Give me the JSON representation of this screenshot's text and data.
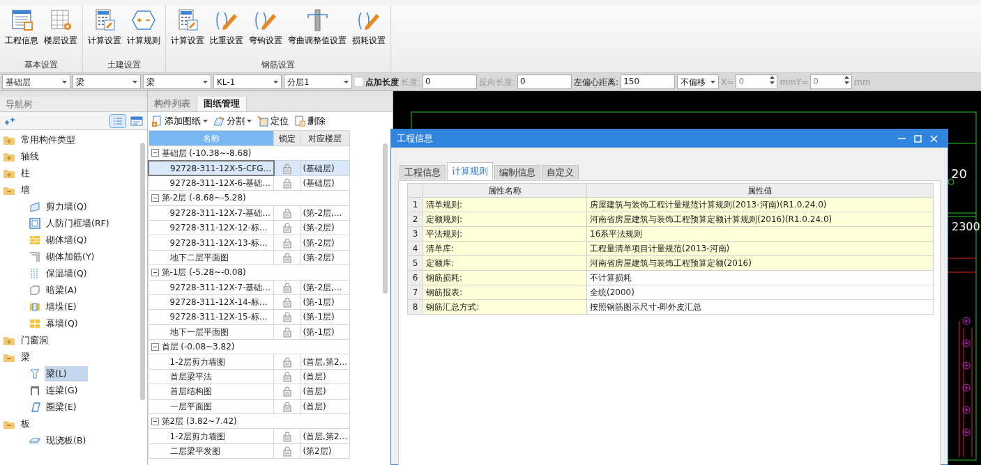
{
  "ribbon": {
    "groups": [
      {
        "label": "基本设置",
        "buttons": [
          "工程信息",
          "楼层设置"
        ]
      },
      {
        "label": "土建设置",
        "buttons": [
          "计算设置",
          "计算规则"
        ]
      },
      {
        "label": "钢筋设置",
        "buttons": [
          "计算设置",
          "比重设置",
          "弯钩设置",
          "弯曲调整值设置",
          "损耗设置"
        ]
      }
    ]
  },
  "toolbar": [
    {
      "kind": "select",
      "value": "基础层"
    },
    {
      "kind": "select",
      "value": "梁"
    },
    {
      "kind": "select",
      "value": "梁"
    },
    {
      "kind": "select",
      "value": "KL-1"
    },
    {
      "kind": "select",
      "value": "分层1"
    },
    {
      "kind": "checkbox",
      "label": "点加长度",
      "checked": false
    },
    {
      "kind": "input",
      "label": "长度:",
      "value": "0",
      "disabled": true
    },
    {
      "kind": "input",
      "label": "反向长度:",
      "value": "0",
      "disabled": true
    },
    {
      "kind": "input",
      "label": "左偏心距离:",
      "value": "150",
      "disabled": false
    },
    {
      "kind": "select",
      "value": "不偏移"
    },
    {
      "kind": "spin",
      "label": "X=",
      "value": "0",
      "disabled": true
    },
    {
      "kind": "spin",
      "label": "mmY=",
      "value": "0",
      "disabled": true
    },
    {
      "kind": "unit",
      "label": "mm",
      "disabled": true
    }
  ],
  "nav": {
    "title": "导航树",
    "items": [
      {
        "label": "常用构件类型",
        "expanded": false
      },
      {
        "label": "轴线",
        "expanded": false
      },
      {
        "label": "柱",
        "expanded": false
      },
      {
        "label": "墙",
        "expanded": true,
        "children": [
          {
            "label": "剪力墙(Q)",
            "selected": false
          },
          {
            "label": "人防门框墙(RF)",
            "selected": false
          },
          {
            "label": "砌体墙(Q)",
            "selected": false
          },
          {
            "label": "砌体加筋(Y)",
            "selected": false
          },
          {
            "label": "保温墙(Q)",
            "selected": false
          },
          {
            "label": "暗梁(A)",
            "selected": false
          },
          {
            "label": "墙垛(E)",
            "selected": false
          },
          {
            "label": "幕墙(Q)",
            "selected": false
          }
        ]
      },
      {
        "label": "门窗洞",
        "expanded": false
      },
      {
        "label": "梁",
        "expanded": true,
        "children": [
          {
            "label": "梁(L)",
            "selected": true
          },
          {
            "label": "连梁(G)",
            "selected": false
          },
          {
            "label": "圈梁(E)",
            "selected": false
          }
        ]
      },
      {
        "label": "板",
        "expanded": true,
        "children": [
          {
            "label": "现浇板(B)",
            "selected": false
          }
        ]
      }
    ]
  },
  "drawings": {
    "tabs": [
      {
        "label": "构件列表",
        "selected": false
      },
      {
        "label": "图纸管理",
        "selected": true
      }
    ],
    "actions": [
      {
        "label": "添加图纸",
        "dropdown": true
      },
      {
        "label": "分割",
        "dropdown": true
      },
      {
        "label": "定位",
        "dropdown": false
      },
      {
        "label": "删除",
        "dropdown": false
      }
    ],
    "columns": [
      "名称",
      "锁定",
      "对应楼层"
    ],
    "groups": [
      {
        "label": "基础层 (-10.38~-8.68)",
        "expanded": true,
        "rows": [
          {
            "name": "92728-311-12X-5-CFG...",
            "floor": "(基础层)",
            "selected": true
          },
          {
            "name": "92728-311-12X-6-基础...",
            "floor": "(基础层)",
            "selected": false
          }
        ]
      },
      {
        "label": "第-2层 (-8.68~-5.28)",
        "expanded": true,
        "rows": [
          {
            "name": "92728-311-12X-7-基础...",
            "floor": "(第-2层,...",
            "selected": false
          },
          {
            "name": "92728-311-12X-12-标...",
            "floor": "(第-2层)",
            "selected": false
          },
          {
            "name": "92728-311-12X-13-标...",
            "floor": "(第-2层)",
            "selected": false
          },
          {
            "name": "地下二层平面图",
            "floor": "(第-2层)",
            "selected": false
          }
        ]
      },
      {
        "label": "第-1层 (-5.28~-0.08)",
        "expanded": true,
        "rows": [
          {
            "name": "92728-311-12X-7-基础...",
            "floor": "(第-2层,...",
            "selected": false
          },
          {
            "name": "92728-311-12X-14-标...",
            "floor": "(第-1层)",
            "selected": false
          },
          {
            "name": "92728-311-12X-15-标...",
            "floor": "(第-1层)",
            "selected": false
          },
          {
            "name": "地下一层平面图",
            "floor": "(第-1层)",
            "selected": false
          }
        ]
      },
      {
        "label": "首层 (-0.08~3.82)",
        "expanded": true,
        "rows": [
          {
            "name": "1-2层剪力墙图",
            "floor": "(首层,第2...",
            "selected": false
          },
          {
            "name": "首层梁平法",
            "floor": "(首层)",
            "selected": false
          },
          {
            "name": "首层结构图",
            "floor": "(首层)",
            "selected": false
          },
          {
            "name": "一层平面图",
            "floor": "(首层)",
            "selected": false
          }
        ]
      },
      {
        "label": "第2层 (3.82~7.42)",
        "expanded": true,
        "rows": [
          {
            "name": "1-2层剪力墙图",
            "floor": "(首层,第2...",
            "selected": false
          },
          {
            "name": "二层梁平发图",
            "floor": "(第2层)",
            "selected": false
          }
        ]
      }
    ]
  },
  "cad_labels": [
    "20",
    "2300"
  ],
  "dialog": {
    "title": "工程信息",
    "tabs": [
      {
        "label": "工程信息",
        "selected": false
      },
      {
        "label": "计算规则",
        "selected": true
      },
      {
        "label": "编制信息",
        "selected": false
      },
      {
        "label": "自定义",
        "selected": false
      }
    ],
    "columns": [
      "属性名称",
      "属性值"
    ],
    "rows": [
      {
        "index": "1",
        "name": "清单规则:",
        "value": "房屋建筑与装饰工程计量规范计算规则(2013-河南)(R1.0.24.0)",
        "highlighted": true
      },
      {
        "index": "2",
        "name": "定额规则:",
        "value": "河南省房屋建筑与装饰工程预算定额计算规则(2016)(R1.0.24.0)",
        "highlighted": true
      },
      {
        "index": "3",
        "name": "平法规则:",
        "value": "16系平法规则",
        "highlighted": true
      },
      {
        "index": "4",
        "name": "清单库:",
        "value": "工程量清单项目计量规范(2013-河南)",
        "highlighted": true
      },
      {
        "index": "5",
        "name": "定额库:",
        "value": "河南省房屋建筑与装饰工程预算定额(2016)",
        "highlighted": true
      },
      {
        "index": "6",
        "name": "钢筋损耗:",
        "value": "不计算损耗",
        "highlighted": false
      },
      {
        "index": "7",
        "name": "钢筋报表:",
        "value": "全统(2000)",
        "highlighted": false
      },
      {
        "index": "8",
        "name": "钢筋汇总方式:",
        "value": "按照钢筋图示尺寸-即外皮汇总",
        "highlighted": false
      }
    ]
  }
}
